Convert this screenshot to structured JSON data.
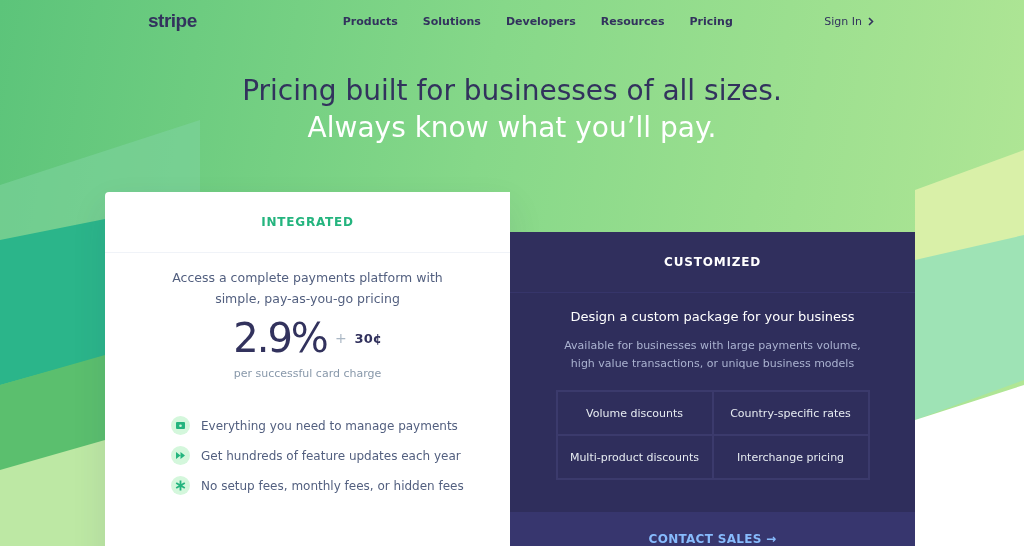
{
  "nav": {
    "logo": "stripe",
    "links": [
      "Products",
      "Solutions",
      "Developers",
      "Resources",
      "Pricing"
    ],
    "sign_in": "Sign In"
  },
  "hero": {
    "line_1": "Pricing built for businesses of all sizes.",
    "line_2": "Always know what you’ll pay."
  },
  "integrated": {
    "title": "INTEGRATED",
    "description": "Access a complete payments platform with simple, pay-as-you-go pricing",
    "rate": "2.9%",
    "plus": "+",
    "fee": "30¢",
    "note": "per successful card charge",
    "features": [
      {
        "kind": "wallet",
        "text": "Everything you need to manage payments"
      },
      {
        "kind": "forward",
        "text": "Get hundreds of feature updates each year"
      },
      {
        "kind": "star",
        "text": "No setup fees, monthly fees, or hidden fees"
      }
    ]
  },
  "customized": {
    "title": "CUSTOMIZED",
    "heading": "Design a custom package for your business",
    "description": "Available for businesses with large payments volume, high value transactions, or unique business models",
    "options": [
      "Volume discounts",
      "Country-specific rates",
      "Multi-product discounts",
      "Interchange pricing"
    ],
    "cta": "CONTACT SALES →"
  }
}
